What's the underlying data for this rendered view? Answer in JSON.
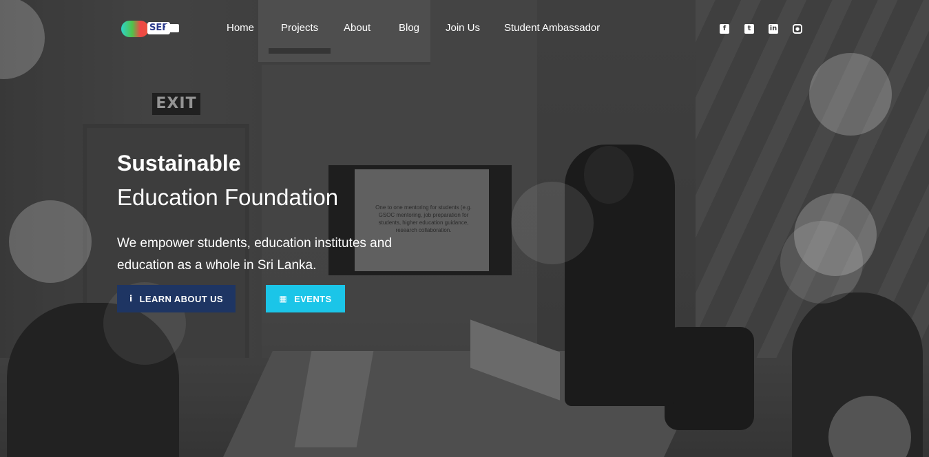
{
  "brand": {
    "logo_text": "SEF"
  },
  "nav": {
    "items": [
      {
        "label": "Home"
      },
      {
        "label": "Projects"
      },
      {
        "label": "About"
      },
      {
        "label": "Blog"
      },
      {
        "label": "Join Us"
      },
      {
        "label": "Student Ambassador"
      }
    ]
  },
  "social": {
    "icons": [
      "facebook-icon",
      "twitter-icon",
      "linkedin-icon",
      "instagram-icon"
    ]
  },
  "background": {
    "exit_sign": "EXIT",
    "screen_text": "One to one mentoring for students (e.g. GSOC mentoring, job preparation for students, higher education guidance, research collaboration."
  },
  "hero": {
    "title_line1": "Sustainable",
    "title_line2": "Education Foundation",
    "tagline": "We empower students, education institutes and education as a whole in Sri Lanka.",
    "btn_about_label": "LEARN ABOUT US",
    "btn_events_label": "EVENTS"
  },
  "colors": {
    "about_button": "#1e3563",
    "events_button": "#1bc5e8",
    "text": "#ffffff"
  }
}
